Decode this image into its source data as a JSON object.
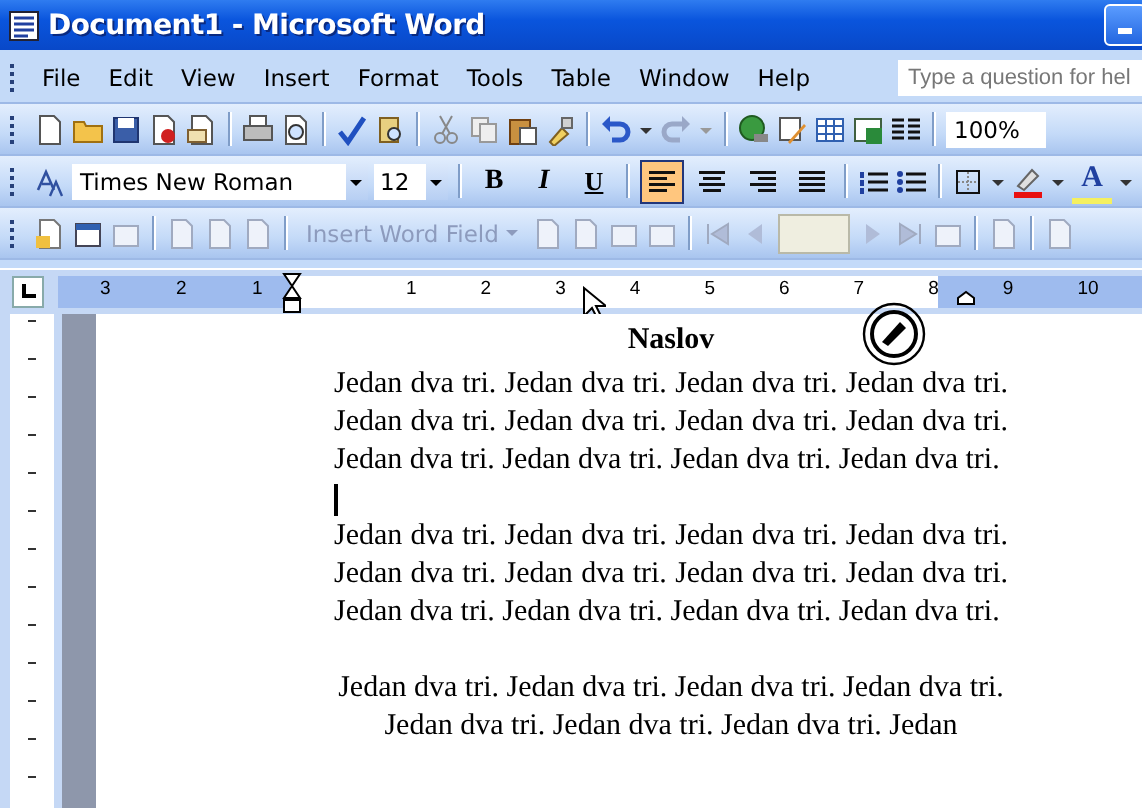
{
  "window": {
    "title": "Document1 - Microsoft Word"
  },
  "menu": [
    {
      "label": "File"
    },
    {
      "label": "Edit"
    },
    {
      "label": "View"
    },
    {
      "label": "Insert"
    },
    {
      "label": "Format"
    },
    {
      "label": "Tools"
    },
    {
      "label": "Table"
    },
    {
      "label": "Window"
    },
    {
      "label": "Help"
    }
  ],
  "help_search": {
    "placeholder": "Type a question for hel"
  },
  "standard_toolbar": {
    "zoom": "100%"
  },
  "formatting_toolbar": {
    "font": "Times New Roman",
    "size": "12",
    "bold": "B",
    "italic": "I",
    "underline": "U",
    "font_color": "A",
    "alignment": [
      {
        "kind": "left",
        "selected": true
      },
      {
        "kind": "center",
        "selected": false
      },
      {
        "kind": "right",
        "selected": false
      },
      {
        "kind": "justify",
        "selected": false
      }
    ]
  },
  "mail_merge_toolbar": {
    "insert_field": {
      "label": "Insert Word Field",
      "disabled": true
    }
  },
  "ruler": {
    "labels": [
      "3",
      "2",
      "1",
      "1",
      "2",
      "3",
      "4",
      "5",
      "6",
      "7",
      "8",
      "9",
      "10"
    ]
  },
  "document": {
    "heading": "Naslov",
    "paragraphs": [
      {
        "kind": "justified",
        "text": "Jedan dva tri. Jedan dva tri. Jedan dva tri. Jedan dva tri. Jedan dva tri. Jedan dva tri. Jedan dva tri. Jedan dva tri. Jedan dva tri. Jedan dva tri. Jedan dva tri. Jedan dva tri."
      },
      {
        "kind": "cursor"
      },
      {
        "kind": "justified",
        "text": "Jedan dva tri. Jedan dva tri. Jedan dva tri. Jedan dva tri. Jedan dva tri. Jedan dva tri. Jedan dva tri. Jedan dva tri. Jedan dva tri. Jedan dva tri. Jedan dva tri. Jedan dva tri."
      },
      {
        "kind": "centered",
        "text": "Jedan dva tri. Jedan dva tri. Jedan dva tri. Jedan dva tri. Jedan dva tri. Jedan dva tri. Jedan dva tri. Jedan"
      }
    ]
  }
}
